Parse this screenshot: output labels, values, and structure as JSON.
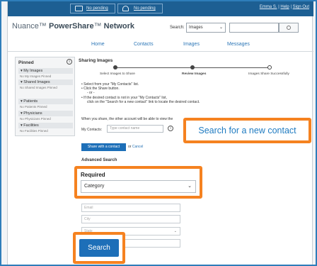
{
  "topbar": {
    "messages_pending": "No pending",
    "contacts_pending": "No pending",
    "user": "Emma S.",
    "help": "Help",
    "sign_out": "Sign Out",
    "sep1": "|",
    "sep2": "|"
  },
  "brand": {
    "name_prefix": "Nuance",
    "name_bold": "PowerShare",
    "name_suffix": "Network"
  },
  "search": {
    "label": "Search:",
    "scope": "Images"
  },
  "nav": {
    "home": "Home",
    "contacts": "Contacts",
    "images": "Images",
    "messages": "Messages"
  },
  "pinned": {
    "title": "Pinned",
    "sections": [
      {
        "label": "My Images",
        "empty": "No My Images Pinned"
      },
      {
        "label": "Shared Images",
        "empty": "No Shared Images Pinned"
      },
      {
        "label": "Patients",
        "empty": "No Patients Pinned"
      },
      {
        "label": "Physicians",
        "empty": "No Physicians Pinned"
      },
      {
        "label": "Facilities",
        "empty": "No Facilities Pinned"
      }
    ]
  },
  "sharing": {
    "title": "Sharing Images",
    "steps": [
      "Select Images to Share",
      "Review Images",
      "Images Share Successfully"
    ],
    "instructions": {
      "line1": "Select from your \"My Contacts\" list.",
      "line2": "Click the Share button.",
      "or": "- or -",
      "line3": "If the desired contact is not in your \"My Contacts\" list,",
      "line4": "click on the \"Search for a new contact\" link to locate the desired contact."
    },
    "when_share": "When you share, the other account will be able to view the",
    "my_contacts_label": "My Contacts:",
    "contact_placeholder": "Type contact name",
    "search_new_contact": "Search for a new contact",
    "share_button": "Share with a contact",
    "or_text": "or",
    "cancel": "Cancel",
    "advanced_search": "Advanced Search",
    "required_label": "Required",
    "category_value": "Category",
    "email_placeholder": "Email",
    "city_placeholder": "City",
    "state_value": "State",
    "search_button": "Search"
  },
  "colors": {
    "accent": "#f58220",
    "primary": "#1d6fb8",
    "topbar": "#1d5f93",
    "link": "#2d77b7"
  }
}
